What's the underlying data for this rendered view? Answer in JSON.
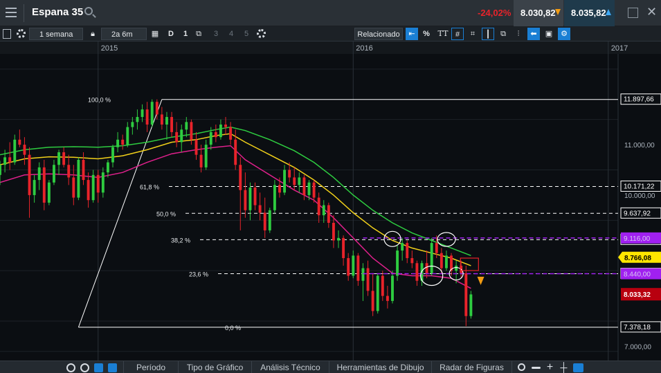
{
  "header": {
    "instrument": "Espana 35",
    "change_pct": "-24,02%",
    "sell_price": "8.030,82",
    "buy_price": "8.035,82"
  },
  "toolbar": {
    "interval": "1 semana",
    "range": "2a 6m",
    "period_buttons": [
      "D",
      "1",
      "3",
      "4",
      "5"
    ],
    "related_label": "Relacionado",
    "percent_label": "%",
    "text_label": "TT"
  },
  "bottom_tabs": [
    "Período",
    "Tipo de Gráfico",
    "Análisis Técnico",
    "Herramientas de Dibujo",
    "Radar de Figuras"
  ],
  "colors": {
    "up": "#2ecc40",
    "down": "#e8232a",
    "ma_fast": "#e0208c",
    "ma_mid": "#f2d11a",
    "ma_slow": "#2ecc40",
    "fib": "#ffffff",
    "support": "#a020f0",
    "price_tag": "#b8000f",
    "current_tag": "#ffe600"
  },
  "chart_data": {
    "type": "candlestick",
    "ylim": [
      6800,
      12800
    ],
    "time_labels": [
      {
        "label": "2015",
        "t": 0
      },
      {
        "label": "2016",
        "t": 52
      },
      {
        "label": "2017",
        "t": 104
      }
    ],
    "t_range": [
      -20,
      106
    ],
    "y_axis_ticks": [
      {
        "value": 11000,
        "label": "11.000,00"
      },
      {
        "value": 10000,
        "label": "10.000,00"
      },
      {
        "value": 7000,
        "label": "7.000,00"
      }
    ],
    "fibonacci": {
      "levels": [
        {
          "pct": "100,0 %",
          "value": 11897.66,
          "label": "11.897,66"
        },
        {
          "pct": "61,8 %",
          "value": 10171.22,
          "label": "10.171,22"
        },
        {
          "pct": "50,0 %",
          "value": 9637.92,
          "label": "9.637,92"
        },
        {
          "pct": "38,2 %",
          "value": 9116.0,
          "label": "9.116,00"
        },
        {
          "pct": "23,6 %",
          "value": 8440.0,
          "label": "8.440,00"
        },
        {
          "pct": "0,0 %",
          "value": 7378.18,
          "label": "7.378,18"
        }
      ]
    },
    "horizontal_lines": [
      {
        "value": 9150,
        "label": "9.116,00",
        "color": "#a020f0"
      },
      {
        "value": 8440,
        "label": "8.440,00",
        "color": "#a020f0"
      }
    ],
    "current_price": {
      "value": 8766.08,
      "label": "8.766,08"
    },
    "last_price": {
      "value": 8033.32,
      "label": "8.033,32"
    },
    "candles": [
      {
        "t": -20,
        "o": 10400,
        "h": 10680,
        "l": 10200,
        "c": 10600
      },
      {
        "t": -19,
        "o": 10600,
        "h": 10900,
        "l": 10450,
        "c": 10750
      },
      {
        "t": -18,
        "o": 10750,
        "h": 11050,
        "l": 10500,
        "c": 10650
      },
      {
        "t": -17,
        "o": 10650,
        "h": 11200,
        "l": 10600,
        "c": 11100
      },
      {
        "t": -16,
        "o": 11100,
        "h": 11300,
        "l": 10950,
        "c": 11000
      },
      {
        "t": -15,
        "o": 11000,
        "h": 11150,
        "l": 10600,
        "c": 10800
      },
      {
        "t": -14,
        "o": 10800,
        "h": 10950,
        "l": 9550,
        "c": 10000
      },
      {
        "t": -13,
        "o": 10000,
        "h": 10400,
        "l": 9850,
        "c": 10300
      },
      {
        "t": -12,
        "o": 10300,
        "h": 10650,
        "l": 10100,
        "c": 10550
      },
      {
        "t": -11,
        "o": 10550,
        "h": 10700,
        "l": 9700,
        "c": 9850
      },
      {
        "t": -10,
        "o": 9850,
        "h": 10300,
        "l": 9800,
        "c": 10250
      },
      {
        "t": -9,
        "o": 10250,
        "h": 10700,
        "l": 10200,
        "c": 10600
      },
      {
        "t": -8,
        "o": 10600,
        "h": 10900,
        "l": 10400,
        "c": 10850
      },
      {
        "t": -7,
        "o": 10850,
        "h": 10950,
        "l": 10550,
        "c": 10600
      },
      {
        "t": -6,
        "o": 10600,
        "h": 10800,
        "l": 10200,
        "c": 10350
      },
      {
        "t": -5,
        "o": 10350,
        "h": 10600,
        "l": 9800,
        "c": 9950
      },
      {
        "t": -4,
        "o": 9950,
        "h": 10750,
        "l": 9900,
        "c": 10700
      },
      {
        "t": -3,
        "o": 10700,
        "h": 10850,
        "l": 10200,
        "c": 10300
      },
      {
        "t": -2,
        "o": 10300,
        "h": 10450,
        "l": 9750,
        "c": 9900
      },
      {
        "t": -1,
        "o": 9900,
        "h": 10500,
        "l": 9850,
        "c": 10400
      },
      {
        "t": 0,
        "o": 10400,
        "h": 10500,
        "l": 9850,
        "c": 10050
      },
      {
        "t": 1,
        "o": 10050,
        "h": 10550,
        "l": 9950,
        "c": 10450
      },
      {
        "t": 2,
        "o": 10450,
        "h": 10700,
        "l": 10350,
        "c": 10650
      },
      {
        "t": 3,
        "o": 10650,
        "h": 11000,
        "l": 10550,
        "c": 10950
      },
      {
        "t": 4,
        "o": 10950,
        "h": 11250,
        "l": 10850,
        "c": 11100
      },
      {
        "t": 5,
        "o": 11100,
        "h": 11200,
        "l": 10900,
        "c": 11000
      },
      {
        "t": 6,
        "o": 11000,
        "h": 11450,
        "l": 10950,
        "c": 11350
      },
      {
        "t": 7,
        "o": 11350,
        "h": 11550,
        "l": 11200,
        "c": 11450
      },
      {
        "t": 8,
        "o": 11450,
        "h": 11700,
        "l": 11300,
        "c": 11550
      },
      {
        "t": 9,
        "o": 11550,
        "h": 11800,
        "l": 11450,
        "c": 11700
      },
      {
        "t": 10,
        "o": 11700,
        "h": 11850,
        "l": 11250,
        "c": 11400
      },
      {
        "t": 11,
        "o": 11400,
        "h": 11900,
        "l": 11350,
        "c": 11850
      },
      {
        "t": 12,
        "o": 11850,
        "h": 11900,
        "l": 11500,
        "c": 11600
      },
      {
        "t": 13,
        "o": 11600,
        "h": 11750,
        "l": 11300,
        "c": 11400
      },
      {
        "t": 14,
        "o": 11400,
        "h": 11650,
        "l": 11100,
        "c": 11550
      },
      {
        "t": 15,
        "o": 11550,
        "h": 11650,
        "l": 11150,
        "c": 11250
      },
      {
        "t": 16,
        "o": 11250,
        "h": 11450,
        "l": 10950,
        "c": 11050
      },
      {
        "t": 17,
        "o": 11050,
        "h": 11400,
        "l": 10850,
        "c": 11300
      },
      {
        "t": 18,
        "o": 11300,
        "h": 11550,
        "l": 11150,
        "c": 11450
      },
      {
        "t": 19,
        "o": 11450,
        "h": 11500,
        "l": 11000,
        "c": 11100
      },
      {
        "t": 20,
        "o": 11100,
        "h": 11250,
        "l": 10700,
        "c": 10800
      },
      {
        "t": 21,
        "o": 10800,
        "h": 11000,
        "l": 10450,
        "c": 10550
      },
      {
        "t": 22,
        "o": 10550,
        "h": 11100,
        "l": 10500,
        "c": 11000
      },
      {
        "t": 23,
        "o": 11000,
        "h": 11350,
        "l": 10900,
        "c": 11250
      },
      {
        "t": 24,
        "o": 11250,
        "h": 11400,
        "l": 11050,
        "c": 11150
      },
      {
        "t": 25,
        "o": 11150,
        "h": 11500,
        "l": 11100,
        "c": 11400
      },
      {
        "t": 26,
        "o": 11400,
        "h": 11550,
        "l": 11200,
        "c": 11350
      },
      {
        "t": 27,
        "o": 11350,
        "h": 11450,
        "l": 11000,
        "c": 11100
      },
      {
        "t": 28,
        "o": 11100,
        "h": 11300,
        "l": 10500,
        "c": 10600
      },
      {
        "t": 29,
        "o": 10600,
        "h": 10750,
        "l": 9300,
        "c": 10100
      },
      {
        "t": 30,
        "o": 10100,
        "h": 10450,
        "l": 9550,
        "c": 9700
      },
      {
        "t": 31,
        "o": 9700,
        "h": 10250,
        "l": 9500,
        "c": 10150
      },
      {
        "t": 32,
        "o": 10150,
        "h": 10250,
        "l": 9700,
        "c": 9800
      },
      {
        "t": 33,
        "o": 9800,
        "h": 10050,
        "l": 9500,
        "c": 9650
      },
      {
        "t": 34,
        "o": 9650,
        "h": 9950,
        "l": 9150,
        "c": 9300
      },
      {
        "t": 35,
        "o": 9300,
        "h": 9750,
        "l": 9250,
        "c": 9700
      },
      {
        "t": 36,
        "o": 9700,
        "h": 10300,
        "l": 9650,
        "c": 10200
      },
      {
        "t": 37,
        "o": 10200,
        "h": 10350,
        "l": 9950,
        "c": 10050
      },
      {
        "t": 38,
        "o": 10050,
        "h": 10600,
        "l": 10000,
        "c": 10500
      },
      {
        "t": 39,
        "o": 10500,
        "h": 10650,
        "l": 10250,
        "c": 10350
      },
      {
        "t": 40,
        "o": 10350,
        "h": 10550,
        "l": 10100,
        "c": 10200
      },
      {
        "t": 41,
        "o": 10200,
        "h": 10450,
        "l": 10050,
        "c": 10350
      },
      {
        "t": 42,
        "o": 10350,
        "h": 10400,
        "l": 9900,
        "c": 10000
      },
      {
        "t": 43,
        "o": 10000,
        "h": 10300,
        "l": 9900,
        "c": 10250
      },
      {
        "t": 44,
        "o": 10250,
        "h": 10300,
        "l": 9850,
        "c": 9950
      },
      {
        "t": 45,
        "o": 9950,
        "h": 10050,
        "l": 9450,
        "c": 9600
      },
      {
        "t": 46,
        "o": 9600,
        "h": 9900,
        "l": 9450,
        "c": 9800
      },
      {
        "t": 47,
        "o": 9800,
        "h": 9850,
        "l": 9350,
        "c": 9450
      },
      {
        "t": 48,
        "o": 9450,
        "h": 9600,
        "l": 8950,
        "c": 9100
      },
      {
        "t": 49,
        "o": 9100,
        "h": 9300,
        "l": 8950,
        "c": 9150
      },
      {
        "t": 50,
        "o": 9150,
        "h": 9200,
        "l": 8600,
        "c": 8750
      },
      {
        "t": 51,
        "o": 8750,
        "h": 8850,
        "l": 8300,
        "c": 8400
      },
      {
        "t": 52,
        "o": 8400,
        "h": 8900,
        "l": 8350,
        "c": 8800
      },
      {
        "t": 53,
        "o": 8800,
        "h": 8850,
        "l": 8200,
        "c": 8300
      },
      {
        "t": 54,
        "o": 8300,
        "h": 8650,
        "l": 7900,
        "c": 8550
      },
      {
        "t": 55,
        "o": 8550,
        "h": 8700,
        "l": 8000,
        "c": 8100
      },
      {
        "t": 56,
        "o": 8100,
        "h": 8450,
        "l": 7600,
        "c": 7700
      },
      {
        "t": 57,
        "o": 7700,
        "h": 8450,
        "l": 7650,
        "c": 8400
      },
      {
        "t": 58,
        "o": 8400,
        "h": 8500,
        "l": 7900,
        "c": 8000
      },
      {
        "t": 59,
        "o": 8000,
        "h": 8200,
        "l": 7750,
        "c": 7900
      },
      {
        "t": 60,
        "o": 7900,
        "h": 8500,
        "l": 7850,
        "c": 8400
      },
      {
        "t": 61,
        "o": 8400,
        "h": 9000,
        "l": 8300,
        "c": 8900
      },
      {
        "t": 62,
        "o": 8900,
        "h": 9150,
        "l": 8700,
        "c": 9050
      },
      {
        "t": 63,
        "o": 9050,
        "h": 9100,
        "l": 8650,
        "c": 8750
      },
      {
        "t": 64,
        "o": 8750,
        "h": 8900,
        "l": 8550,
        "c": 8650
      },
      {
        "t": 65,
        "o": 8650,
        "h": 8700,
        "l": 8200,
        "c": 8300
      },
      {
        "t": 66,
        "o": 8300,
        "h": 8700,
        "l": 8200,
        "c": 8650
      },
      {
        "t": 67,
        "o": 8650,
        "h": 8900,
        "l": 8350,
        "c": 8450
      },
      {
        "t": 68,
        "o": 8450,
        "h": 9150,
        "l": 8400,
        "c": 9050
      },
      {
        "t": 69,
        "o": 9050,
        "h": 9200,
        "l": 8750,
        "c": 8850
      },
      {
        "t": 70,
        "o": 8850,
        "h": 8950,
        "l": 8450,
        "c": 8550
      },
      {
        "t": 71,
        "o": 8550,
        "h": 8900,
        "l": 8500,
        "c": 8800
      },
      {
        "t": 72,
        "o": 8800,
        "h": 8850,
        "l": 8400,
        "c": 8500
      },
      {
        "t": 73,
        "o": 8500,
        "h": 8700,
        "l": 8250,
        "c": 8600
      },
      {
        "t": 74,
        "o": 8600,
        "h": 8700,
        "l": 8350,
        "c": 8450
      },
      {
        "t": 75,
        "o": 8450,
        "h": 8600,
        "l": 7400,
        "c": 7600
      },
      {
        "t": 76,
        "o": 7600,
        "h": 8100,
        "l": 7550,
        "c": 8030
      }
    ],
    "ma_fast": [
      [
        -20,
        10250
      ],
      [
        -15,
        10400
      ],
      [
        -10,
        10420
      ],
      [
        -5,
        10400
      ],
      [
        0,
        10350
      ],
      [
        5,
        10450
      ],
      [
        10,
        10650
      ],
      [
        15,
        10820
      ],
      [
        20,
        10900
      ],
      [
        24,
        10950
      ],
      [
        27,
        10980
      ],
      [
        30,
        10700
      ],
      [
        35,
        10400
      ],
      [
        40,
        10100
      ],
      [
        44,
        9900
      ],
      [
        48,
        9550
      ],
      [
        52,
        9150
      ],
      [
        56,
        8750
      ],
      [
        60,
        8450
      ],
      [
        64,
        8400
      ],
      [
        68,
        8400
      ],
      [
        72,
        8350
      ],
      [
        76,
        8150
      ]
    ],
    "ma_mid": [
      [
        -20,
        10600
      ],
      [
        -15,
        10720
      ],
      [
        -10,
        10760
      ],
      [
        -5,
        10750
      ],
      [
        0,
        10720
      ],
      [
        5,
        10780
      ],
      [
        10,
        10900
      ],
      [
        15,
        11050
      ],
      [
        20,
        11100
      ],
      [
        24,
        11180
      ],
      [
        27,
        11220
      ],
      [
        30,
        11050
      ],
      [
        35,
        10800
      ],
      [
        40,
        10550
      ],
      [
        44,
        10300
      ],
      [
        48,
        10000
      ],
      [
        52,
        9650
      ],
      [
        56,
        9350
      ],
      [
        60,
        9100
      ],
      [
        64,
        8950
      ],
      [
        68,
        8850
      ],
      [
        72,
        8750
      ],
      [
        76,
        8600
      ]
    ],
    "ma_slow": [
      [
        -20,
        10800
      ],
      [
        -15,
        10900
      ],
      [
        -10,
        10950
      ],
      [
        -5,
        10960
      ],
      [
        0,
        10950
      ],
      [
        5,
        10980
      ],
      [
        10,
        11050
      ],
      [
        15,
        11150
      ],
      [
        20,
        11220
      ],
      [
        24,
        11300
      ],
      [
        27,
        11350
      ],
      [
        30,
        11280
      ],
      [
        35,
        11100
      ],
      [
        40,
        10880
      ],
      [
        44,
        10650
      ],
      [
        48,
        10350
      ],
      [
        52,
        10000
      ],
      [
        56,
        9700
      ],
      [
        60,
        9450
      ],
      [
        64,
        9250
      ],
      [
        68,
        9100
      ],
      [
        72,
        8950
      ],
      [
        76,
        8800
      ]
    ],
    "fib_trendline": [
      [
        13,
        11897.66
      ],
      [
        -4,
        7378.18
      ]
    ]
  }
}
